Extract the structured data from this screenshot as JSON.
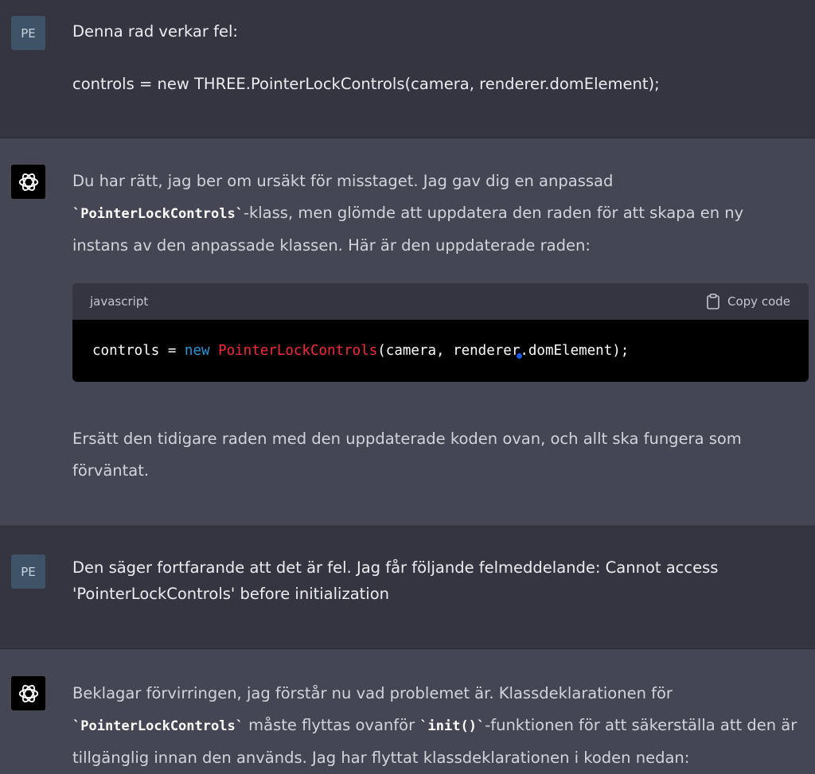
{
  "messages": [
    {
      "role": "user",
      "avatar": "PE",
      "lines": [
        "Denna rad verkar fel:",
        "controls = new THREE.PointerLockControls(camera, renderer.domElement);"
      ]
    },
    {
      "role": "assistant",
      "avatar_icon": "openai-logo-icon",
      "para1": {
        "a": "Du har rätt, jag ber om ursäkt för misstaget. Jag gav dig en anpassad",
        "code": "`PointerLockControls`",
        "b": "-klass, men glömde att uppdatera den raden för att skapa en ny instans av den anpassade klassen. Här är den uppdaterade raden:"
      },
      "code_block": {
        "language": "javascript",
        "copy_label": "Copy code",
        "code": {
          "t1": "controls = ",
          "kw": "new",
          "sp": " ",
          "cls": "PointerLockControls",
          "t2": "(camera, renderer.domElement);"
        }
      },
      "para2": "Ersätt den tidigare raden med den uppdaterade koden ovan, och allt ska fungera som förväntat."
    },
    {
      "role": "user",
      "avatar": "PE",
      "text": "Den säger fortfarande att det är fel. Jag får följande felmeddelande: Cannot access 'PointerLockControls' before initialization"
    },
    {
      "role": "assistant",
      "avatar_icon": "openai-logo-icon",
      "para": {
        "a": "Beklagar förvirringen, jag förstår nu vad problemet är. Klassdeklarationen för",
        "code1": "`PointerLockControls`",
        "b": " måste flyttas ovanför ",
        "code2": "`init()`",
        "c": "-funktionen för att säkerställa att den är tillgänglig innan den används. Jag har flyttat klassdeklarationen i koden nedan:"
      }
    }
  ],
  "colors": {
    "user_bg": "#343541",
    "assistant_bg": "#444654",
    "code_keyword": "#2e95d3",
    "code_class": "#f22c3d"
  }
}
